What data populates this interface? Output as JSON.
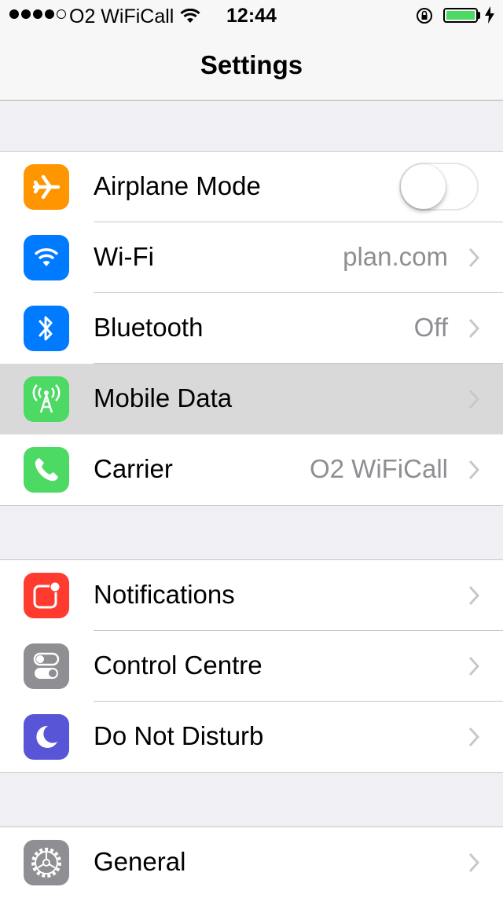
{
  "status_bar": {
    "carrier": "O2 WiFiCall",
    "time": "12:44",
    "signal_bars_filled": 4,
    "signal_bars_total": 5,
    "battery_level": 1.0,
    "battery_color": "#4cd964"
  },
  "navbar": {
    "title": "Settings"
  },
  "groups": [
    {
      "rows": [
        {
          "label": "Airplane Mode",
          "icon": "airplane-icon",
          "icon_color": "#ff9500",
          "toggle": false
        },
        {
          "label": "Wi-Fi",
          "value": "plan.com",
          "icon": "wifi-icon",
          "icon_color": "#007aff"
        },
        {
          "label": "Bluetooth",
          "value": "Off",
          "icon": "bluetooth-icon",
          "icon_color": "#007aff"
        },
        {
          "label": "Mobile Data",
          "icon": "antenna-icon",
          "icon_color": "#4cd964",
          "highlighted": true
        },
        {
          "label": "Carrier",
          "value": "O2 WiFiCall",
          "icon": "phone-icon",
          "icon_color": "#4cd964"
        }
      ]
    },
    {
      "rows": [
        {
          "label": "Notifications",
          "icon": "notifications-icon",
          "icon_color": "#ff3b30"
        },
        {
          "label": "Control Centre",
          "icon": "control-centre-icon",
          "icon_color": "#8e8e93"
        },
        {
          "label": "Do Not Disturb",
          "icon": "moon-icon",
          "icon_color": "#5856d6"
        }
      ]
    },
    {
      "rows": [
        {
          "label": "General",
          "icon": "gear-icon",
          "icon_color": "#8e8e93"
        }
      ]
    }
  ]
}
